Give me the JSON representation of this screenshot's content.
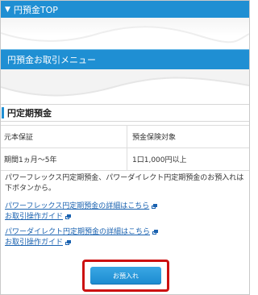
{
  "header": {
    "arrow_glyph": "▼",
    "title": "円預金TOP"
  },
  "menu_bar": {
    "title": "円預金お取引メニュー"
  },
  "section": {
    "title": "円定期預金",
    "rows": [
      [
        "元本保証",
        "預金保険対象"
      ],
      [
        "期間1ヵ月〜5年",
        "1口1,000円以上"
      ]
    ],
    "description": "パワーフレックス円定期預金、パワーダイレクト円定期預金のお預入れは下ボタンから。"
  },
  "links": {
    "powerflex_detail": "パワーフレックス円定期預金の詳細はこちら",
    "powerflex_guide": "お取引操作ガイド",
    "powerdirect_detail": "パワーダイレクト円定期預金の詳細はこちら",
    "powerdirect_guide": "お取引操作ガイド",
    "icon": "external-window-icon"
  },
  "button": {
    "label": "お預入れ"
  },
  "colors": {
    "brand_blue": "#1f8fd3",
    "link_blue": "#1a62b0",
    "highlight_red": "#cc1111"
  }
}
